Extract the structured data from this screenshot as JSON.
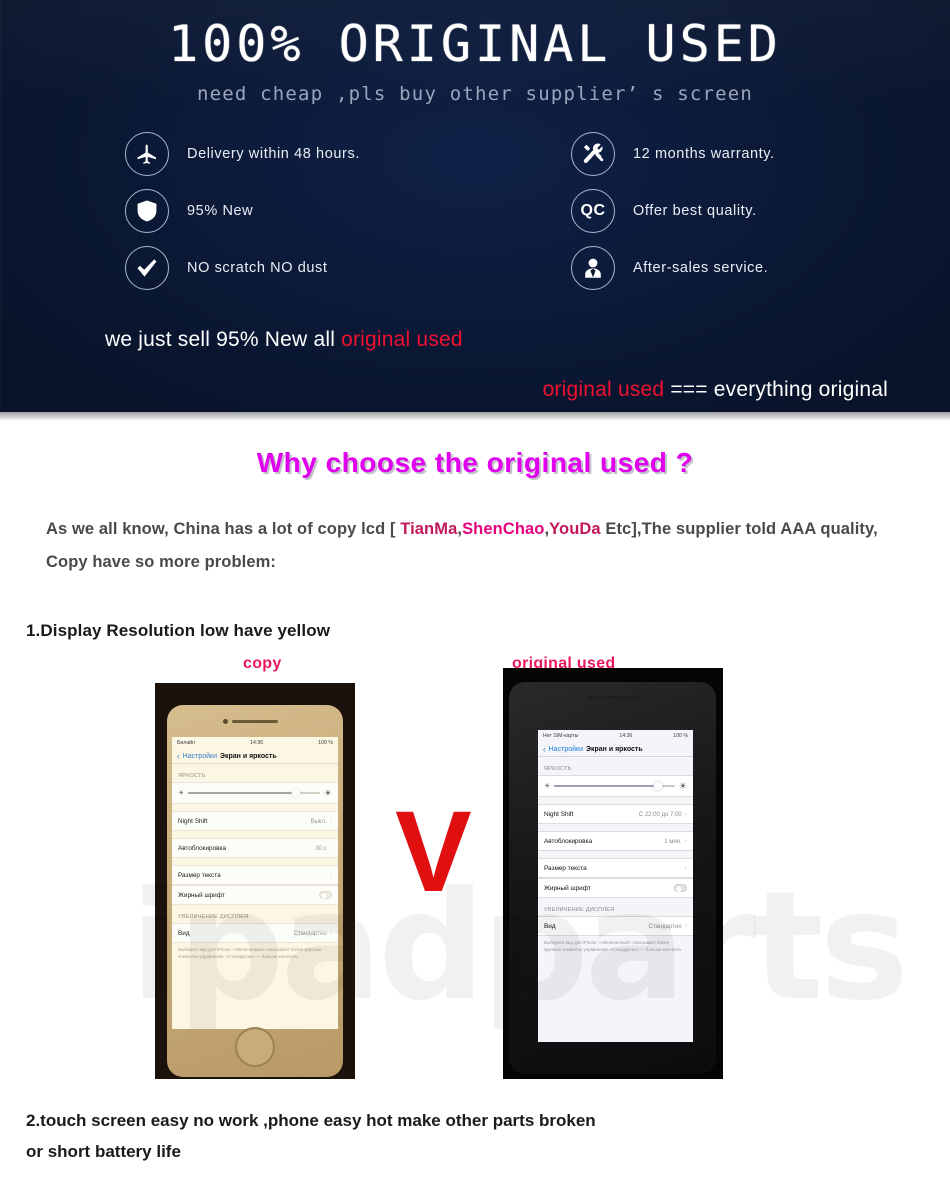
{
  "banner": {
    "title": "100% ORIGINAL USED",
    "subtitle": "need cheap ,pls buy other supplier’ s screen",
    "features_left": [
      {
        "icon": "airplane-icon",
        "label": "Delivery  within  48  hours."
      },
      {
        "icon": "shield-icon",
        "label": "95% New"
      },
      {
        "icon": "check-icon",
        "label": "NO scratch NO dust"
      }
    ],
    "features_right": [
      {
        "icon": "tools-icon",
        "label": "12  months  warranty."
      },
      {
        "icon": "qc-icon",
        "label": "Offer  best  quality.",
        "icon_text": "QC"
      },
      {
        "icon": "support-agent-icon",
        "label": "After-sales  service."
      }
    ],
    "sell_line_plain": "we just sell 95% New all ",
    "sell_line_highlight": "original used",
    "equals_highlight": "original used",
    "equals_rest": " ===  everything original",
    "accent_red": "#f01030"
  },
  "why": {
    "title": "Why choose the original used  ?",
    "title_color": "#e000ee",
    "intro_part1": "As we all know, China has a lot of copy lcd [ ",
    "brand1": "TianMa",
    "comma1": ",",
    "brand2": "ShenChao",
    "comma2": ",",
    "brand3": "YouDa",
    "intro_part2": " Etc],The supplier told AAA quality, Copy have so more problem:",
    "brand1_color": "#c2185b",
    "brand2_color": "#e6007e",
    "brand3_color": "#c2185b"
  },
  "point1": {
    "heading": "1.Display Resolution low have yellow",
    "label_copy": "copy",
    "label_original": "original used",
    "label_color": "#e8175d",
    "vs_symbol": "V",
    "watermark": "ipadparts"
  },
  "phone_copy": {
    "status_carrier": "Билайн",
    "status_time": "14:36",
    "status_battery": "100 %",
    "nav_back": "Настройки",
    "nav_title": "Экран и яркость",
    "section_brightness": "ЯРКОСТЬ",
    "row_nightshift_label": "Night Shift",
    "row_nightshift_value": "Выкл.",
    "row_autolock_label": "Автоблокировка",
    "row_autolock_value": "30 с",
    "row_textsize_label": "Размер текста",
    "row_bold_label": "Жирный шрифт",
    "section_display_zoom": "УВЕЛИЧЕНИЕ ДИСПЛЕЯ",
    "row_view_label": "Вид",
    "row_view_value": "Стандартно",
    "footnote": "Выберите вид для iPhone. «Увеличенный» показывает более крупные элементы управления. «Стандартно» — больше контента."
  },
  "phone_original": {
    "status_carrier": "Нет SIM-карты",
    "status_time": "14:36",
    "status_battery": "100 %",
    "nav_back": "Настройки",
    "nav_title": "Экран и яркость",
    "section_brightness": "ЯРКОСТЬ",
    "row_nightshift_label": "Night Shift",
    "row_nightshift_value": "С 22:00 до 7:00",
    "row_autolock_label": "Автоблокировка",
    "row_autolock_value": "1 мин.",
    "row_textsize_label": "Размер текста",
    "row_bold_label": "Жирный шрифт",
    "section_display_zoom": "УВЕЛИЧЕНИЕ ДИСПЛЕЯ",
    "row_view_label": "Вид",
    "row_view_value": "Стандартно",
    "footnote": "Выберите вид для iPhone. «Увеличенный» показывает более крупные элементы управления. «Стандартно» — больше контента."
  },
  "point2": {
    "line1": "2.touch screen easy no work ,phone easy hot make other parts broken",
    "line2": "or short battery life"
  }
}
